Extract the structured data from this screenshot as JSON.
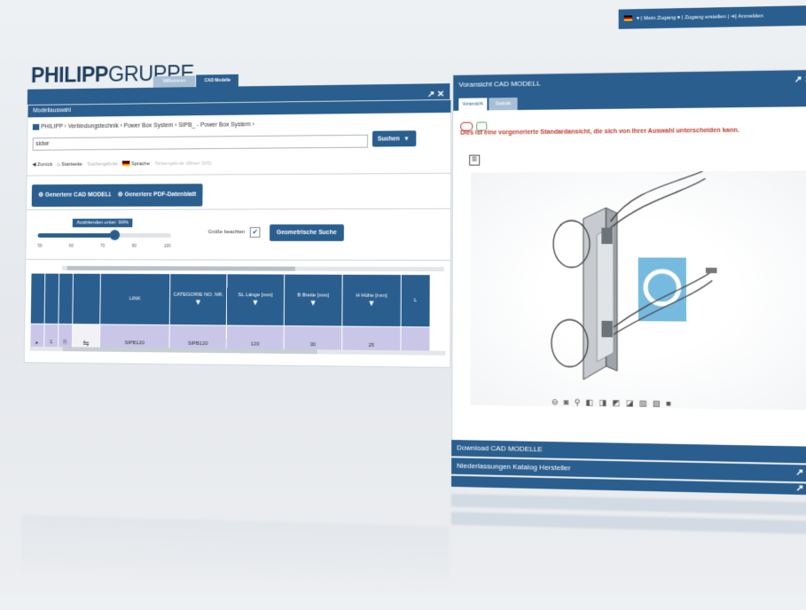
{
  "topbar": {
    "flag": "de-flag",
    "items": [
      "Mein Zugang",
      "Zugang erstellen",
      "Anmelden"
    ]
  },
  "logo": {
    "bold": "PHILIPP",
    "light": "GRUPPE"
  },
  "tabs": [
    "Willkommen",
    "CAD Modelle"
  ],
  "left": {
    "title": "Modellauswahl",
    "breadcrumb": [
      "PHILIPP",
      "Verbindungstechnik",
      "Power Box System",
      "SIPB_ - Power Box System"
    ],
    "search_value": "sidwr",
    "search_button": "Suchen",
    "actions": [
      "Zurück",
      "Startseite",
      "Suchergebnis",
      "Sprache",
      "Teileergebnis öffnen (0/0)"
    ],
    "generate_cad": "Generiere CAD MODELL",
    "generate_pdf": "Generiere PDF-Datenblatt",
    "slider": {
      "label": "Ausblenden unter: 90%",
      "value": 0.58,
      "ticks": [
        "50",
        "60",
        "70",
        "80",
        "100"
      ]
    },
    "size_label": "Größe beachten",
    "size_checked": true,
    "geo_search": "Geometrische Suche",
    "table": {
      "headers": [
        "",
        "",
        "",
        "",
        "LINK",
        "CATEGORIE NO. NR.",
        "SL Länge [mm]",
        "B Breite [mm]",
        "H Höhe [mm]",
        "L"
      ],
      "row": [
        "▸",
        "1",
        "",
        "",
        "SIPB120",
        "SIPB120",
        "120",
        "30",
        "25",
        ""
      ]
    }
  },
  "right": {
    "title": "Voransicht CAD MODELL",
    "tabs": [
      "Voransicht",
      "Statistik"
    ],
    "notice": "Dies ist eine vorgenerierte Standardansicht, die sich von Ihrer Auswahl unterscheiden kann.",
    "toolbar_icons": [
      "view-front-icon",
      "view-back-icon",
      "view-top-icon",
      "view-left-icon",
      "view-right-icon",
      "view-iso-icon",
      "view-iso2-icon",
      "view-iso3-icon",
      "view-iso4-icon",
      "view-iso5-icon"
    ],
    "accordion": [
      "Download CAD MODELLE",
      "Niederlassungen Katalog Hersteller"
    ]
  }
}
